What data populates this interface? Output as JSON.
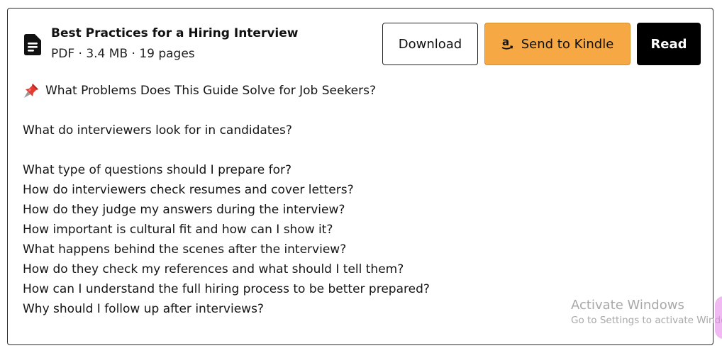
{
  "document": {
    "title": "Best Practices for a Hiring Interview",
    "meta": "PDF · 3.4 MB · 19 pages",
    "icon": "document-icon"
  },
  "actions": {
    "download_label": "Download",
    "kindle_label": "Send to Kindle",
    "kindle_icon": "amazon-icon",
    "kindle_color": "#f5a843",
    "read_label": "Read"
  },
  "content": {
    "heading_icon": "pushpin-icon",
    "heading": "What Problems Does This Guide Solve for Job Seekers?",
    "intro_question": "What do interviewers look for in candidates?",
    "questions": [
      "What type of questions should I prepare for?",
      "How do interviewers check resumes and cover letters?",
      "How do they judge my answers during the interview?",
      "How important is cultural fit and how can I show it?",
      "What happens behind the scenes after the interview?",
      "How do they check my references and what should I tell them?",
      "How can I understand the full hiring process to be better prepared?",
      "Why should I follow up after interviews?"
    ]
  },
  "watermark": {
    "title": "Activate Windows",
    "subtitle": "Go to Settings to activate Windo"
  }
}
